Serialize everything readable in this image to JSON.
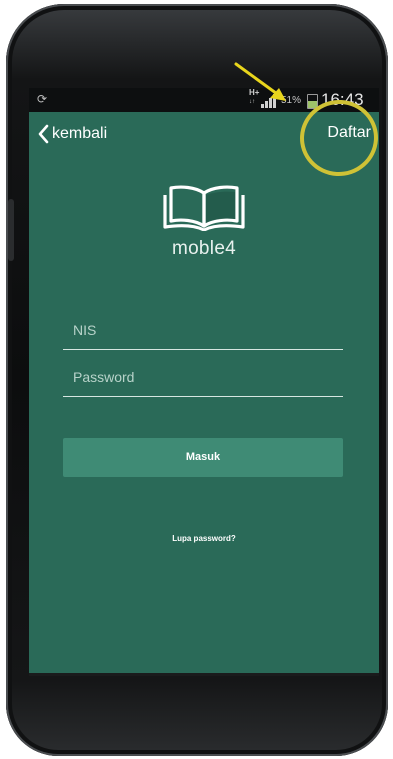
{
  "status_bar": {
    "left_icon": "sync-icon",
    "network": "H+",
    "network_sub": "↓↑",
    "signal_icon": "signal-icon",
    "battery_pct": "51%",
    "battery_icon": "battery-icon",
    "time": "16:43"
  },
  "appbar": {
    "back_icon": "chevron-left-icon",
    "back_label": "kembali",
    "right_action": "Daftar"
  },
  "logo": {
    "icon": "open-book-icon",
    "app_name": "moble4"
  },
  "form": {
    "nis_placeholder": "NIS",
    "password_placeholder": "Password",
    "submit_label": "Masuk",
    "forgot_label": "Lupa password?"
  },
  "annotation": {
    "circle_color": "#cfc236",
    "arrow_color": "#e8d51c"
  },
  "colors": {
    "screen_bg": "#2a6a58",
    "button_bg": "#3f8b75"
  }
}
